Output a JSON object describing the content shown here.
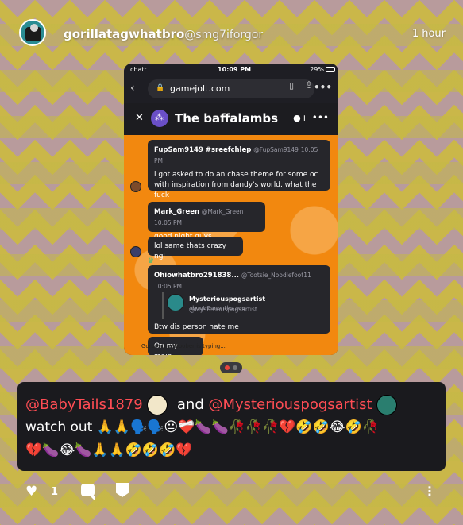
{
  "post": {
    "username": "gorillatagwhatbro",
    "handle": "@smg7iforgor",
    "time": "1 hour",
    "likes": "1"
  },
  "screenshot": {
    "status": {
      "carrier": "chatr",
      "clock": "10:09 PM",
      "battery": "29%"
    },
    "browser": {
      "domain": "gamejolt.com"
    },
    "chat": {
      "title": "The baffalambs",
      "messages": [
        {
          "author": "FupSam9149 #sreefchlep",
          "handle": "@FupSam9149",
          "time": "10:05 PM",
          "text": "i got asked to do an chase theme for some oc with inspiration from dandy's world. what the fuck"
        },
        {
          "author": "Mark_Green",
          "handle": "@Mark_Green",
          "time": "10:05 PM",
          "text": "good night guys"
        },
        {
          "text": "lol same thats crazy ngl"
        },
        {
          "author": "Ohiowhatbro291838...",
          "handle": "@Tootsie_Noodlefoot11",
          "time": "10:05 PM",
          "quoted_author": "Mysteriouspogsartist",
          "quoted_handle": "@Mysteriouspogsartist",
          "quoted_time": "about 2 months ago",
          "text": "Btw dis person hate me"
        },
        {
          "text": "On my main"
        }
      ],
      "typing": "GordontheeGoober is typing..."
    }
  },
  "caption": {
    "mention1": "@BabyTails1879",
    "and": "and",
    "mention2": "@Mysteriouspogsartist",
    "line2": "watch out 🙏🙏🗣️🗣️😐❤️‍🩹🍆🍆🥀🥀🥀💔🤣🤣😂🤣🥀",
    "line3": "💔🍆😂🍆🙏🙏🤣🤣🤣💔"
  },
  "icons": [
    "heart-icon",
    "comment-icon",
    "gamejolt-icon",
    "more-icon"
  ]
}
